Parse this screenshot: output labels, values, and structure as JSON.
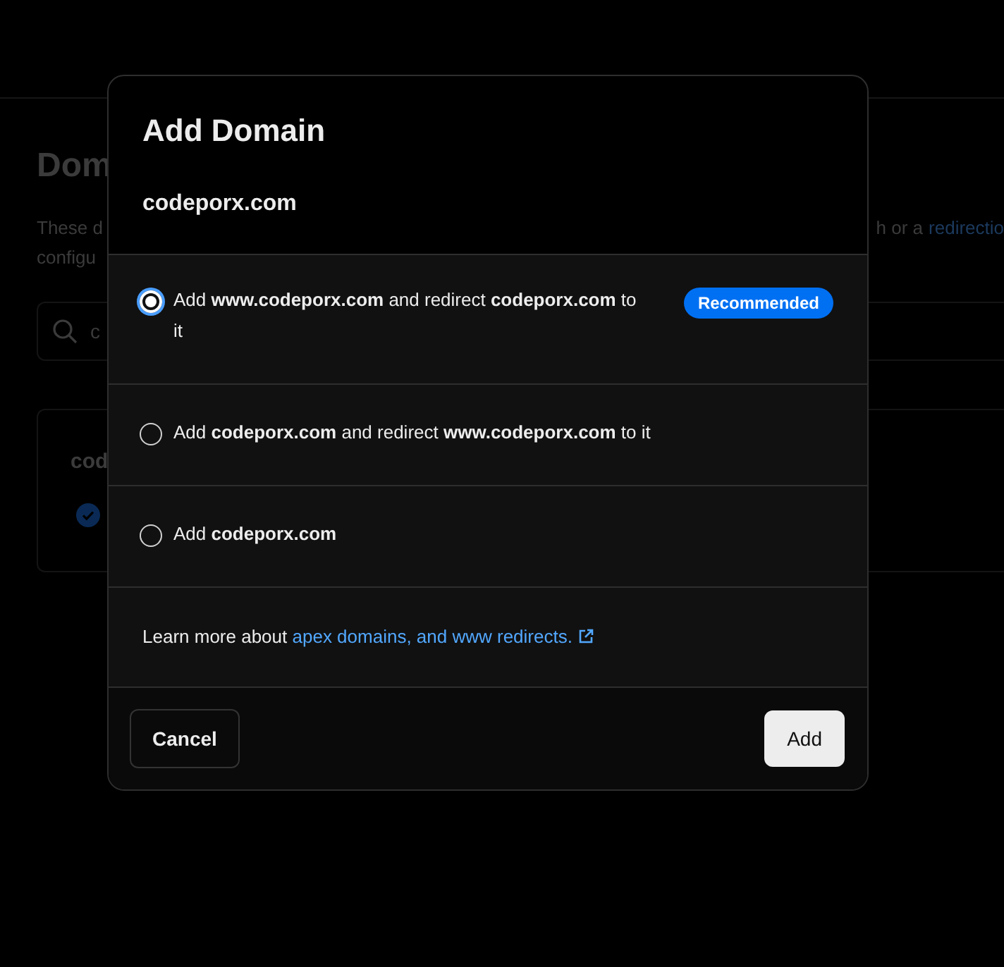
{
  "background": {
    "heading": "Dom",
    "description_start": [
      "These d",
      "configu"
    ],
    "description_end": "h or a",
    "description_link": "redirectio",
    "search": {
      "value": "c"
    },
    "card": {
      "title": "cod"
    }
  },
  "dialog": {
    "title": "Add Domain",
    "domain": "codeporx.com",
    "options": [
      {
        "label": "Add **www.codeporx.com** and redirect **codeporx.com** to it",
        "selected": true,
        "badge": "Recommended"
      },
      {
        "label": "Add **codeporx.com** and redirect **www.codeporx.com** to it",
        "selected": false
      },
      {
        "label": "Add **codeporx.com**",
        "selected": false
      }
    ],
    "learn_more": {
      "text": "Learn more about",
      "link": "apex domains, and www redirects."
    },
    "buttons": {
      "cancel": "Cancel",
      "confirm": "Add"
    }
  }
}
